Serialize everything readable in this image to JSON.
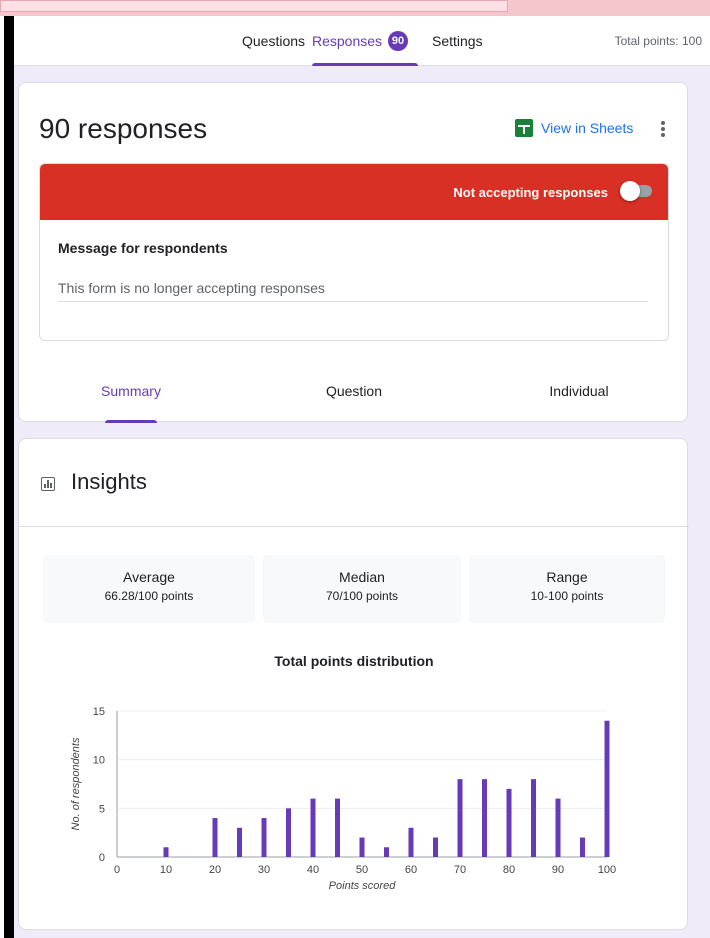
{
  "nav": {
    "tabs": [
      {
        "label": "Questions"
      },
      {
        "label": "Responses",
        "badge": "90"
      },
      {
        "label": "Settings"
      }
    ],
    "active": "Responses",
    "total_points": "Total points: 100"
  },
  "responses_card": {
    "title": "90 responses",
    "view_in_sheets": "View in Sheets",
    "banner": "Not accepting responses",
    "message_label": "Message for respondents",
    "message_value": "This form is no longer accepting responses",
    "tabs": [
      "Summary",
      "Question",
      "Individual"
    ],
    "active_tab": "Summary"
  },
  "insights": {
    "title": "Insights",
    "stats": [
      {
        "label": "Average",
        "value": "66.28/100 points"
      },
      {
        "label": "Median",
        "value": "70/100 points"
      },
      {
        "label": "Range",
        "value": "10-100 points"
      }
    ]
  },
  "colors": {
    "accent": "#673ab7",
    "banner": "#d93025",
    "sheets": "#188038",
    "link": "#1a73e8",
    "bar": "#673ab7"
  },
  "chart_data": {
    "type": "bar",
    "title": "Total points distribution",
    "xlabel": "Points scored",
    "ylabel": "No. of respondents",
    "x": [
      10,
      20,
      25,
      30,
      35,
      40,
      45,
      50,
      55,
      60,
      65,
      70,
      75,
      80,
      85,
      90,
      95,
      100
    ],
    "values": [
      1,
      4,
      3,
      4,
      5,
      6,
      6,
      2,
      1,
      3,
      2,
      8,
      8,
      7,
      8,
      6,
      2,
      14
    ],
    "xticks": [
      0,
      10,
      20,
      30,
      40,
      50,
      60,
      70,
      80,
      90,
      100
    ],
    "yticks": [
      0,
      5,
      10,
      15
    ],
    "xlim": [
      0,
      100
    ],
    "ylim": [
      0,
      15
    ],
    "grid": true
  }
}
